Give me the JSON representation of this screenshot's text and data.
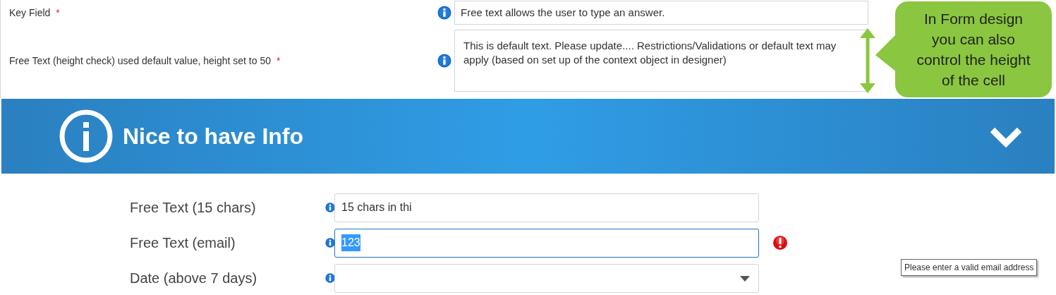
{
  "top_fields": [
    {
      "label": "Key Field",
      "required_mark": "*",
      "kind": "input",
      "value": "Free text allows the user to type an answer."
    },
    {
      "label": "Free Text (height check) used default value, height set to 50",
      "required_mark": "*",
      "kind": "textarea",
      "value": "This is default text. Please update.... Restrictions/Validations or default text may apply (based on set up of the context object in designer)"
    }
  ],
  "callout": {
    "text": "In Form design you can also control the height of the cell"
  },
  "section": {
    "title": "Nice to have Info",
    "expanded": true
  },
  "fields": [
    {
      "label": "Free Text (15 chars)",
      "kind": "text",
      "value": "15 chars in thi",
      "focused": false,
      "error": false
    },
    {
      "label": "Free Text (email)",
      "kind": "text",
      "value": "123",
      "focused": true,
      "error": true,
      "tooltip": "Please enter a valid email address"
    },
    {
      "label": "Date (above 7 days)",
      "kind": "select",
      "focused": false,
      "error": false
    }
  ]
}
